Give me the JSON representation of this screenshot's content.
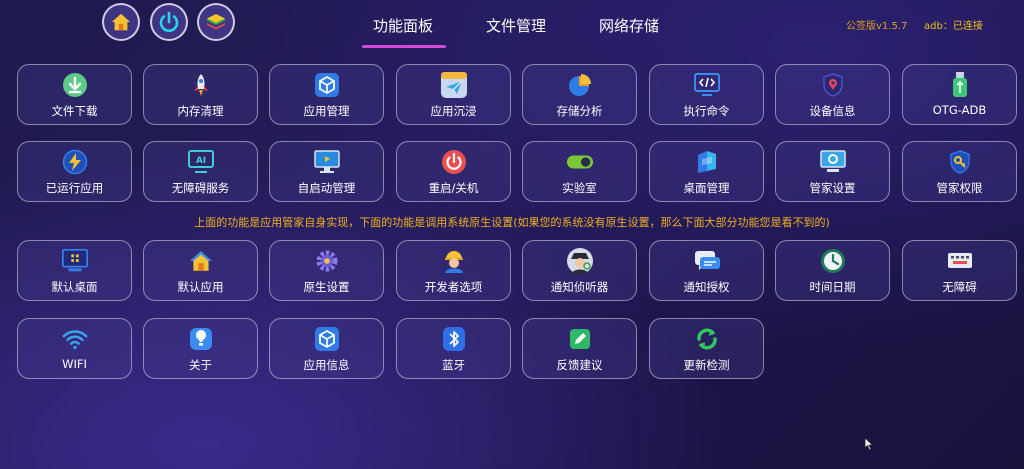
{
  "top_buttons": [
    {
      "name": "home-button",
      "icon": "home-icon"
    },
    {
      "name": "power-button",
      "icon": "power-icon"
    },
    {
      "name": "layers-button",
      "icon": "layers-icon"
    }
  ],
  "tabs": [
    {
      "label": "功能面板",
      "active": true
    },
    {
      "label": "文件管理",
      "active": false
    },
    {
      "label": "网络存储",
      "active": false
    }
  ],
  "version": "公签版v1.5.7",
  "adb_status": "adb：已连接",
  "notice": "上面的功能是应用管家自身实现，下面的功能是调用系统原生设置(如果您的系统没有原生设置，那么下面大部分功能您是看不到的)",
  "rows": [
    [
      {
        "label": "文件下载",
        "icon": "download-icon"
      },
      {
        "label": "内存清理",
        "icon": "rocket-icon"
      },
      {
        "label": "应用管理",
        "icon": "cube-icon"
      },
      {
        "label": "应用沉浸",
        "icon": "paper-plane-icon"
      },
      {
        "label": "存储分析",
        "icon": "pie-chart-icon"
      },
      {
        "label": "执行命令",
        "icon": "code-monitor-icon"
      },
      {
        "label": "设备信息",
        "icon": "location-shield-icon"
      },
      {
        "label": "OTG-ADB",
        "icon": "usb-icon"
      }
    ],
    [
      {
        "label": "已运行应用",
        "icon": "lightning-icon"
      },
      {
        "label": "无障碍服务",
        "icon": "ai-monitor-icon"
      },
      {
        "label": "自启动管理",
        "icon": "desktop-icon"
      },
      {
        "label": "重启/关机",
        "icon": "power-icon"
      },
      {
        "label": "实验室",
        "icon": "toggle-icon"
      },
      {
        "label": "桌面管理",
        "icon": "desktop-layers-icon"
      },
      {
        "label": "管家设置",
        "icon": "settings-monitor-icon"
      },
      {
        "label": "管家权限",
        "icon": "key-shield-icon"
      }
    ],
    [
      {
        "label": "默认桌面",
        "icon": "default-desktop-icon"
      },
      {
        "label": "默认应用",
        "icon": "home-icon"
      },
      {
        "label": "原生设置",
        "icon": "gear-icon"
      },
      {
        "label": "开发者选项",
        "icon": "worker-icon"
      },
      {
        "label": "通知侦听器",
        "icon": "detective-icon"
      },
      {
        "label": "通知授权",
        "icon": "chat-icon"
      },
      {
        "label": "时间日期",
        "icon": "clock-icon"
      },
      {
        "label": "无障碍",
        "icon": "keyboard-icon"
      }
    ],
    [
      {
        "label": "WIFI",
        "icon": "wifi-icon"
      },
      {
        "label": "关于",
        "icon": "info-badge-icon"
      },
      {
        "label": "应用信息",
        "icon": "cube-icon"
      },
      {
        "label": "蓝牙",
        "icon": "bluetooth-icon"
      },
      {
        "label": "反馈建议",
        "icon": "edit-icon"
      },
      {
        "label": "更新检测",
        "icon": "refresh-icon"
      }
    ]
  ]
}
